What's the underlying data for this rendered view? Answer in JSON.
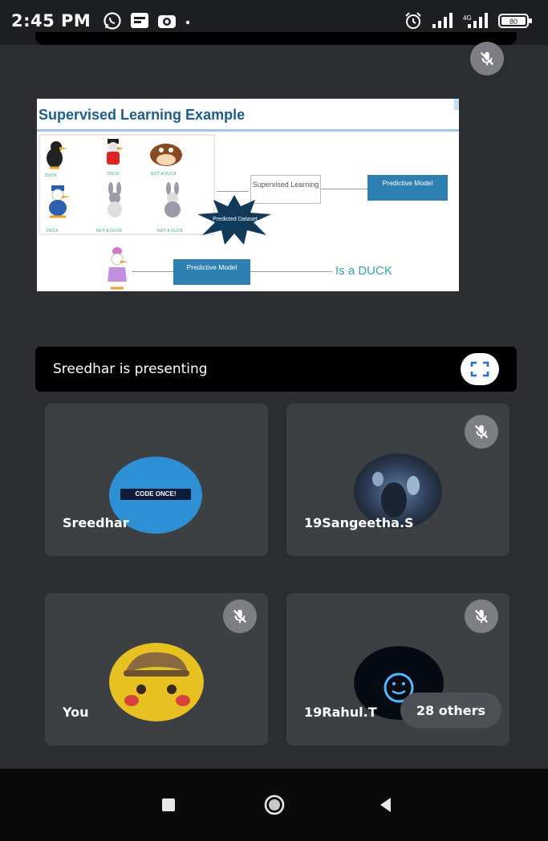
{
  "status_bar": {
    "time": "2:45 PM",
    "left_icons": [
      "whatsapp-icon",
      "message-icon",
      "camera-icon",
      "dot-icon"
    ],
    "right_icons": [
      "alarm-icon",
      "signal-icon",
      "signal-icon",
      "battery-icon"
    ],
    "battery": "80"
  },
  "presentation": {
    "slide": {
      "title": "Supervised Learning Example",
      "character_labels": [
        "DUCK",
        "DUCK",
        "NOT A DUCK",
        "DUCK",
        "NOT A DUCK",
        "NOT A DUCK"
      ],
      "supervised_box": "Supervised Learning",
      "predictive_model_top": "Predictive Model",
      "burst_label": "Predicted Dataset",
      "predictive_model_bottom": "Predictive Model",
      "result": "Is a DUCK"
    },
    "presenting_text": "Sreedhar is presenting",
    "fullscreen_icon": "fullscreen-icon"
  },
  "participants": [
    {
      "name": "Sreedhar",
      "avatar_text": "CODE ONCE!",
      "avatar_color": "#2d8fd4",
      "muted": false
    },
    {
      "name": "19Sangeetha.S",
      "muted": true
    },
    {
      "name": "You",
      "muted": true
    },
    {
      "name": "19Rahul.T",
      "muted": true
    }
  ],
  "others_chip": "28 others",
  "colors": {
    "background": "#2c2d30",
    "tile": "#3c4043",
    "muted_badge": "#7d7f84",
    "slide_title": "#1c5d92",
    "slide_blue": "#2e80b3",
    "slide_result": "#2ea7a4"
  },
  "nav_bar": {
    "icons": [
      "recent-apps-icon",
      "home-icon",
      "back-icon"
    ]
  }
}
